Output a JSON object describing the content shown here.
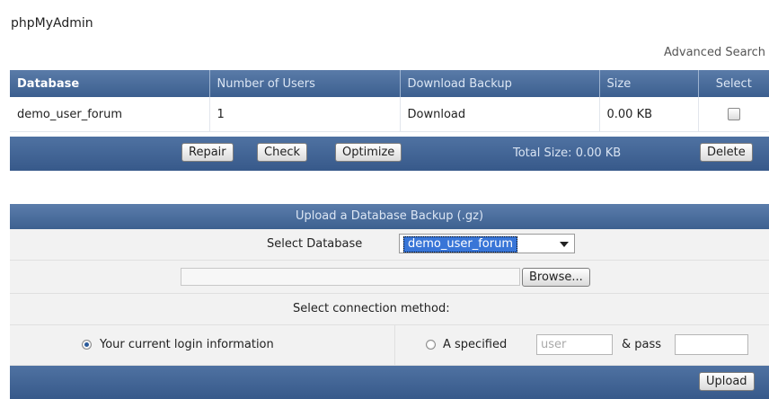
{
  "app": {
    "title": "phpMyAdmin"
  },
  "header": {
    "advanced_search": "Advanced Search"
  },
  "table": {
    "columns": [
      "Database",
      "Number of Users",
      "Download Backup",
      "Size",
      "Select"
    ],
    "rows": [
      {
        "database": "demo_user_forum",
        "users": "1",
        "backup": "Download",
        "size": "0.00 KB",
        "selected": false
      }
    ]
  },
  "actions": {
    "repair": "Repair",
    "check": "Check",
    "optimize": "Optimize",
    "total_size": "Total Size: 0.00 KB",
    "delete": "Delete"
  },
  "upload": {
    "section_title": "Upload a Database Backup (.gz)",
    "select_db_label": "Select Database",
    "select_db_value": "demo_user_forum",
    "browse": "Browse...",
    "connection_label": "Select connection method:",
    "option_current": "Your current login information",
    "option_specified": "A specified",
    "user_placeholder": "user",
    "pass_label": "& pass",
    "upload_button": "Upload"
  }
}
